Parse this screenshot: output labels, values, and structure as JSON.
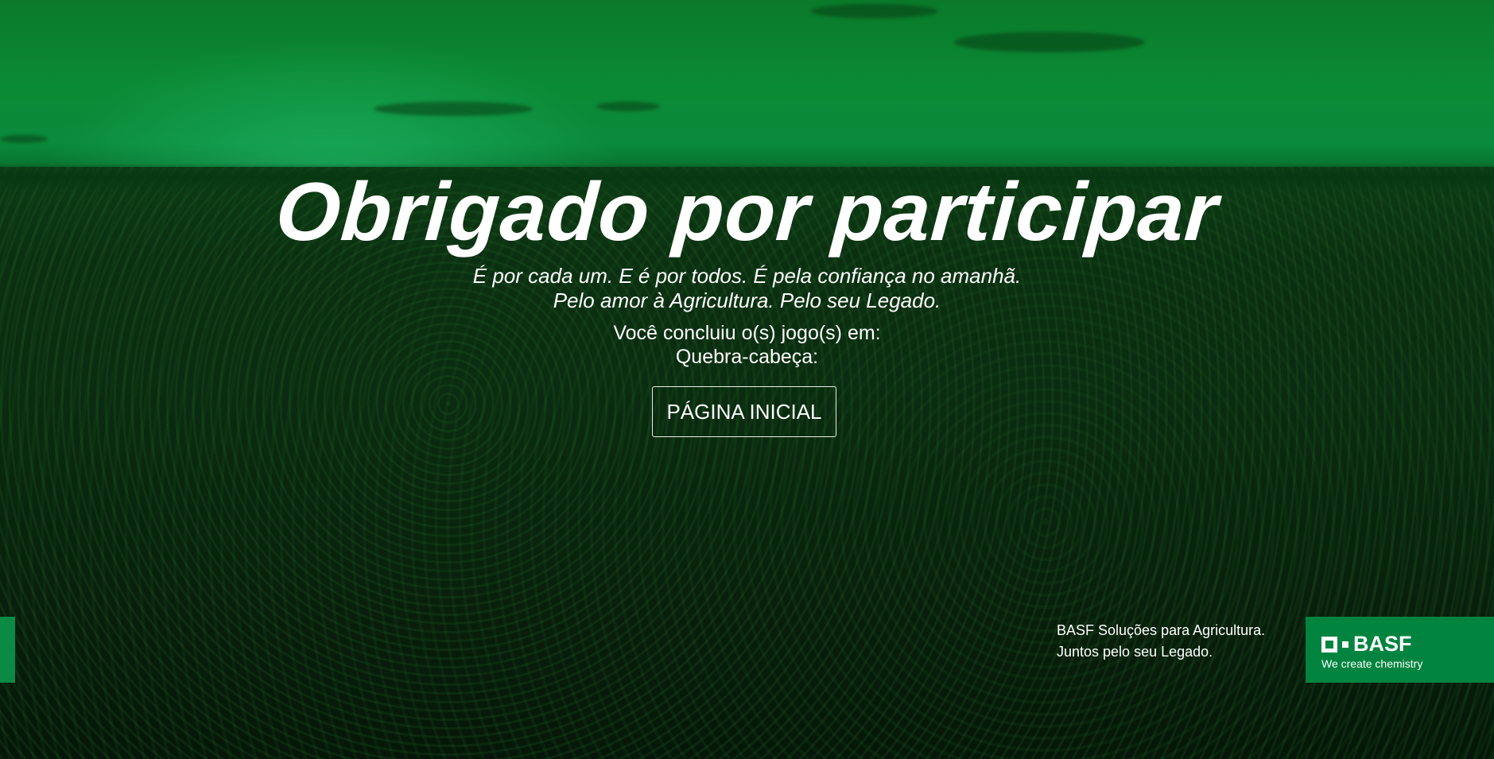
{
  "hero": {
    "title": "Obrigado por participar",
    "tagline_line1": "É por cada um. E é por todos. É pela confiança no amanhã.",
    "tagline_line2": "Pelo amor à Agricultura. Pelo seu Legado."
  },
  "result": {
    "completed_label": "Você concluiu o(s) jogo(s) em:",
    "game_label": "Quebra-cabeça:"
  },
  "actions": {
    "home_button_label": "PÁGINA INICIAL"
  },
  "footer": {
    "line1": "BASF Soluções para Agricultura.",
    "line2": "Juntos pelo seu Legado."
  },
  "brand": {
    "logo_text": "BASF",
    "claim": "We create chemistry",
    "color": "#00843f"
  },
  "colors": {
    "sky": "#0b8a35",
    "field": "#0a2a0f",
    "text": "#ffffff"
  }
}
